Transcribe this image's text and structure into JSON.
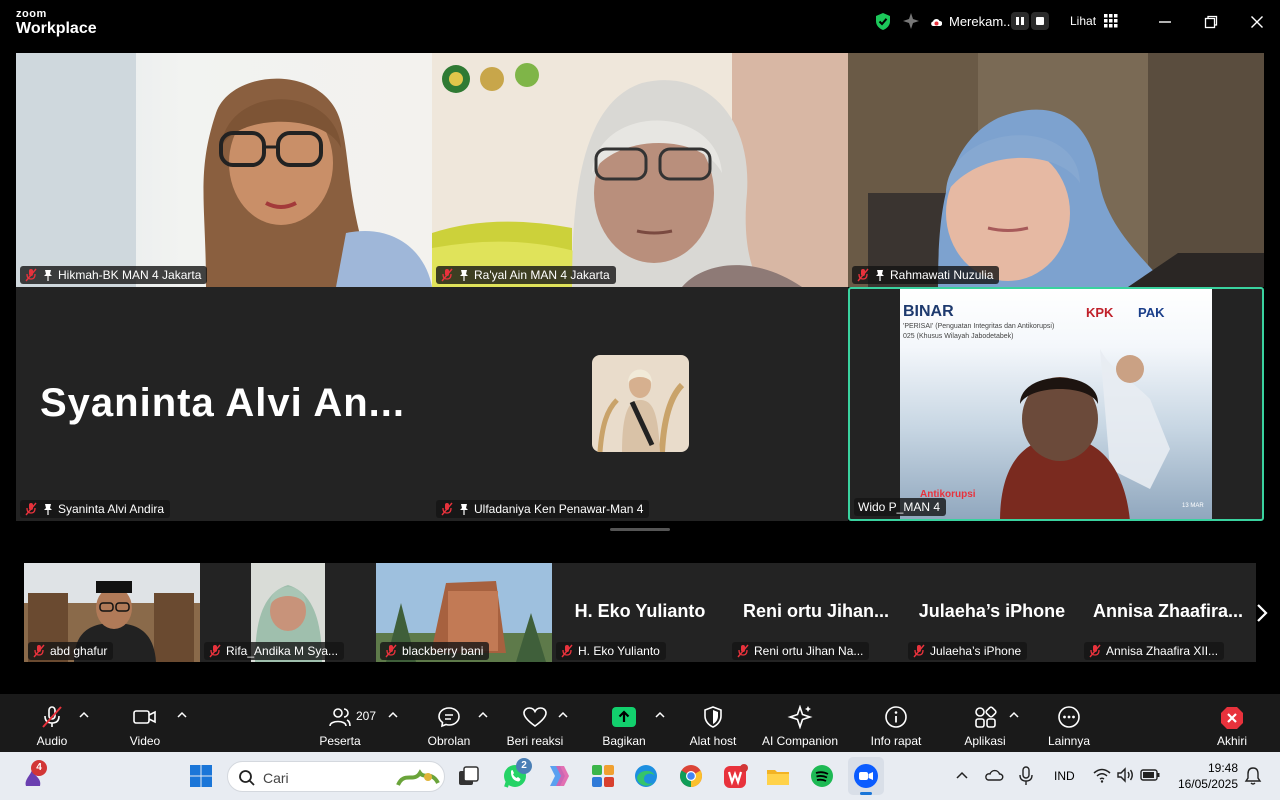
{
  "app": {
    "brand_top": "zoom",
    "brand_bottom": "Workplace"
  },
  "titlebar": {
    "recording_label": "Merekam...",
    "view_label": "Lihat"
  },
  "participants": [
    {
      "name": "Hikmah-BK MAN 4 Jakarta"
    },
    {
      "name": "Ra'yal Ain MAN 4 Jakarta"
    },
    {
      "name": "Rahmawati Nuzulia"
    },
    {
      "name": "Syaninta Alvi Andira",
      "display": "Syaninta  Alvi  An..."
    },
    {
      "name": "Ulfadaniya Ken Penawar-Man 4"
    },
    {
      "name": "Wido P_MAN 4"
    }
  ],
  "share_slide": {
    "title": "BINAR",
    "subtitle": "'PERISAI' (Penguatan Integritas dan Antikorupsi)",
    "subtitle2": "025 (Khusus Wilayah Jabodetabek)",
    "kpk": "KPK",
    "pak": "PAK",
    "corner": "13 MAR",
    "bottom_text": "Antikorupsi"
  },
  "filmstrip": [
    {
      "name": "abd ghafur"
    },
    {
      "name": "Rifa_Andika M Sya..."
    },
    {
      "name": "blackberry bani"
    },
    {
      "name": "H. Eko Yulianto",
      "display": "H. Eko Yulianto"
    },
    {
      "name": "Reni ortu Jihan Na...",
      "display": "Reni ortu Jihan..."
    },
    {
      "name": "Julaeha’s iPhone",
      "display": "Julaeha’s iPhone"
    },
    {
      "name": "Annisa Zhaafira XII...",
      "display": "Annisa  Zhaafira..."
    }
  ],
  "toolbar": {
    "audio": "Audio",
    "video": "Video",
    "participants": "Peserta",
    "participants_count": "207",
    "chat": "Obrolan",
    "react": "Beri reaksi",
    "share": "Bagikan",
    "host_tools": "Alat host",
    "ai": "AI Companion",
    "info": "Info rapat",
    "apps": "Aplikasi",
    "more": "Lainnya",
    "leave": "Akhiri"
  },
  "taskbar": {
    "search_placeholder": "Cari",
    "lang": "IND",
    "time": "19:48",
    "date": "16/05/2025",
    "widgets_badge": "4",
    "whatsapp_badge": "2"
  },
  "colors": {
    "active_speaker": "#3ad29f",
    "share_green": "#12d06d",
    "leave_red": "#e8323c",
    "mic_off_red": "#e8323c"
  }
}
